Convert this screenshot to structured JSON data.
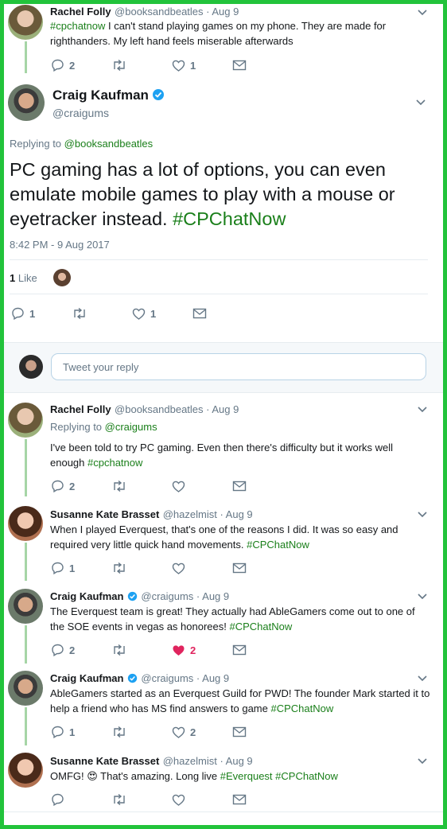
{
  "colors": {
    "accent_green": "#1a7f1a",
    "frame_green": "#22c33b",
    "like_red": "#e0245e",
    "muted": "#657786"
  },
  "tweets": [
    {
      "name": "Rachel Folly",
      "handle_time": "@booksandbeatles · Aug 9",
      "text_hashtag": "#cpchatnow",
      "text": " I can't stand playing games on my phone. They are made for righthanders. My left hand feels miserable afterwards",
      "replies": "2",
      "retweets": "",
      "likes": "1"
    },
    {
      "name": "Craig Kaufman",
      "handle": "@craigums",
      "replying_prefix": "Replying to ",
      "replying_to": "@booksandbeatles",
      "text": "PC gaming has a lot of options, you can even emulate mobile games to play with a mouse or eyetracker instead. ",
      "text_hashtag": "#CPChatNow",
      "timestamp": "8:42 PM - 9 Aug 2017",
      "likes_count": "1",
      "likes_label": "Like",
      "replies": "1",
      "retweets": "",
      "likes": "1"
    },
    {
      "name": "Rachel Folly",
      "handle_time": "@booksandbeatles · Aug 9",
      "replying_prefix": "Replying to ",
      "replying_to": "@craigums",
      "text": "I've been told to try PC gaming. Even then there's difficulty but it works well enough ",
      "text_hashtag": "#cpchatnow",
      "replies": "2",
      "retweets": "",
      "likes": ""
    },
    {
      "name": "Susanne Kate Brasset",
      "handle_time": "@hazelmist · Aug 9",
      "text": "When I played Everquest, that's one of the reasons I did. It was so easy and required very little quick hand movements. ",
      "text_hashtag": "#CPChatNow",
      "replies": "1",
      "retweets": "",
      "likes": ""
    },
    {
      "name": "Craig Kaufman",
      "handle_time": "@craigums · Aug 9",
      "text": "The Everquest team is great! They actually had AbleGamers come out to one of the SOE events in vegas as honorees! ",
      "text_hashtag": "#CPChatNow",
      "replies": "2",
      "retweets": "",
      "likes": "2"
    },
    {
      "name": "Craig Kaufman",
      "handle_time": "@craigums · Aug 9",
      "text": "AbleGamers started as an Everquest Guild for PWD! The founder Mark started it to help a friend who has MS find answers to game ",
      "text_hashtag": "#CPChatNow",
      "replies": "1",
      "retweets": "",
      "likes": "2"
    },
    {
      "name": "Susanne Kate Brasset",
      "handle_time": "@hazelmist · Aug 9",
      "text_a": "OMFG! ",
      "emoji": "😍",
      "text_b": " That's amazing. Long live ",
      "text_hashtag": "#Everquest",
      "text_hashtag2": "#CPChatNow",
      "replies": "",
      "retweets": "",
      "likes": ""
    }
  ],
  "reply_box": {
    "placeholder": "Tweet your reply"
  }
}
